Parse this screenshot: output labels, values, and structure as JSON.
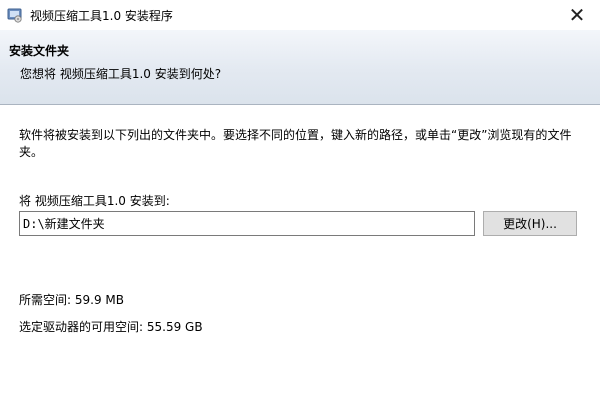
{
  "window": {
    "title": "视频压缩工具1.0 安装程序",
    "close_glyph": "✕"
  },
  "header": {
    "title": "安装文件夹",
    "subtitle": "您想将 视频压缩工具1.0 安装到何处?"
  },
  "body": {
    "intro": "软件将被安装到以下列出的文件夹中。要选择不同的位置，键入新的路径，或单击“更改”浏览现有的文件夹。",
    "destination_label": "将 视频压缩工具1.0 安装到:",
    "destination_value": "D:\\新建文件夹",
    "change_button": "更改(H)...",
    "space_required": "所需空间: 59.9 MB",
    "space_available": "选定驱动器的可用空间: 55.59 GB"
  },
  "icons": {
    "app": "installer-icon",
    "close": "close-icon"
  }
}
